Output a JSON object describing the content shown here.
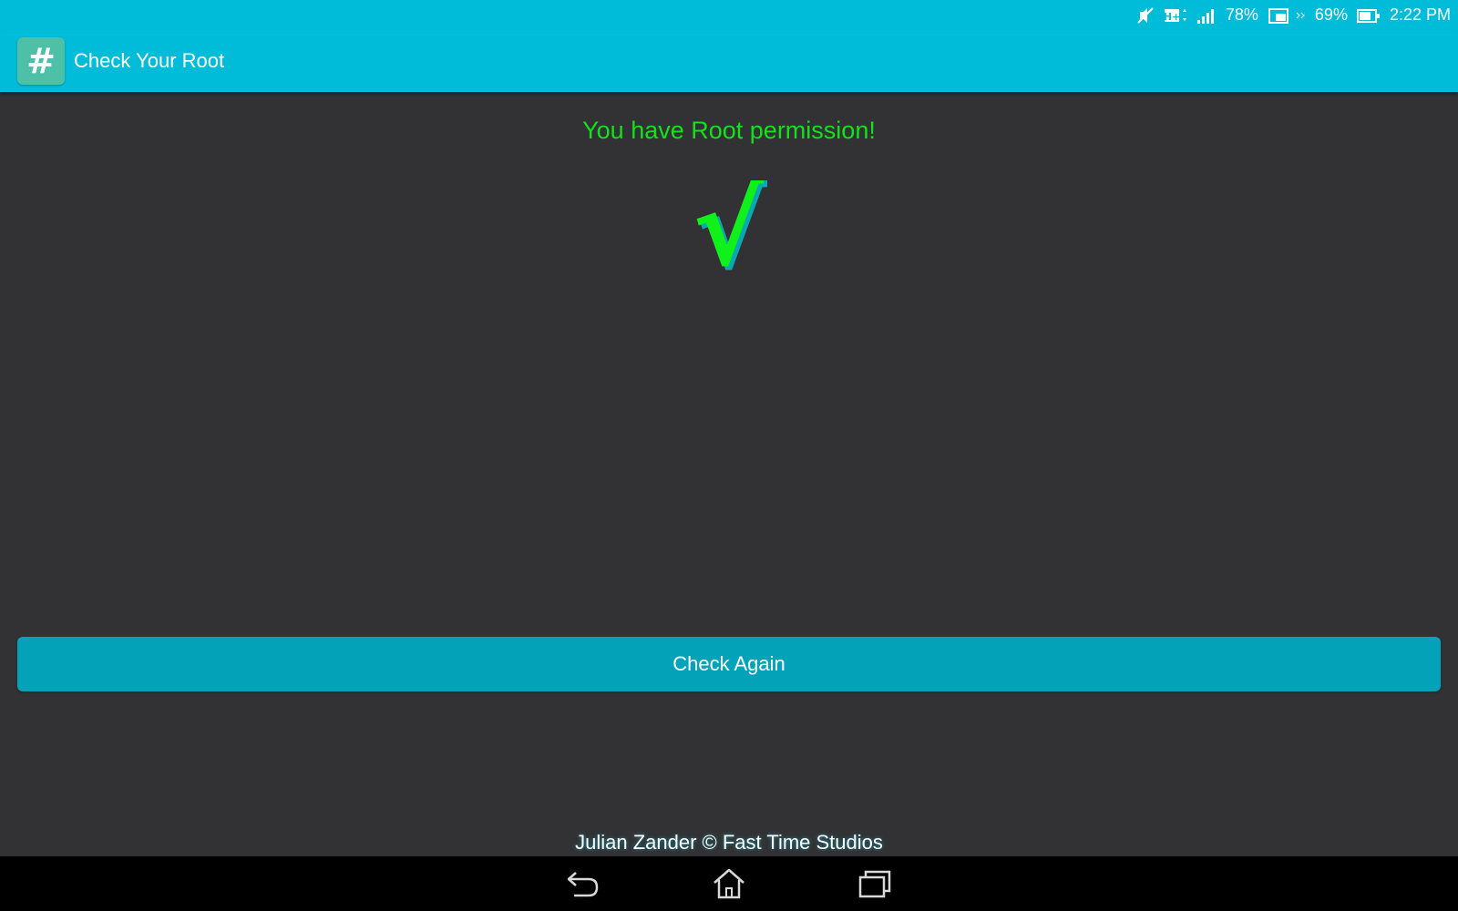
{
  "status_bar": {
    "battery_primary": "78%",
    "battery_secondary": "69%",
    "time": "2:22 PM",
    "icons": [
      "mute-icon",
      "hplus-network-icon",
      "signal-icon",
      "tablet-battery-icon",
      "dock-battery-icon"
    ]
  },
  "action_bar": {
    "app_icon_glyph": "#",
    "title": "Check Your Root"
  },
  "main": {
    "result_message": "You have Root permission!",
    "result_symbol": "√",
    "check_again_label": "Check Again",
    "footer_credit": "Julian Zander © Fast Time Studios"
  },
  "nav_bar": {
    "buttons": [
      "back",
      "home",
      "recent-apps"
    ]
  },
  "colors": {
    "accent": "#00bcd8",
    "button": "#03a2b8",
    "success": "#11e21a",
    "background": "#323234"
  }
}
